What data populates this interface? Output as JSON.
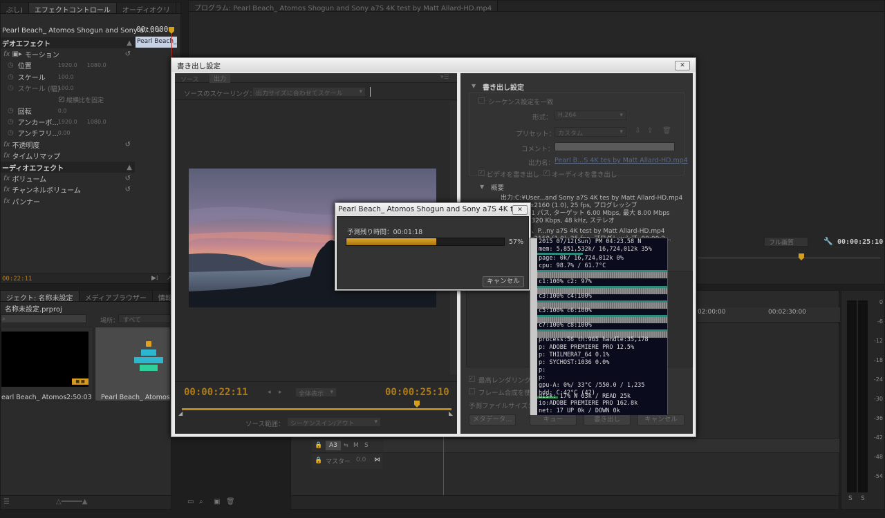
{
  "effect_panel": {
    "tabs": [
      "ぶし)",
      "エフェクトコントロール",
      "オーディオクリ"
    ],
    "clip_name": "Pearl Beach_ Atomos Shogun and Sony a7...",
    "timecode": "00:0000",
    "clip_bar": "Pearl Beach_",
    "current_time": "00:22:11",
    "rows": [
      {
        "label": "デオエフェクト",
        "kind": "header"
      },
      {
        "label": "モーション",
        "kind": "group"
      },
      {
        "label": "位置",
        "kind": "prop",
        "v1": "1920.0",
        "v2": "1080.0"
      },
      {
        "label": "スケール",
        "kind": "prop",
        "v1": "100.0",
        "v2": ""
      },
      {
        "label": "スケール (幅)",
        "kind": "prop-dim",
        "v1": "100.0",
        "v2": ""
      },
      {
        "label": "縦横比を固定",
        "kind": "check"
      },
      {
        "label": "回転",
        "kind": "prop",
        "v1": "0.0",
        "v2": ""
      },
      {
        "label": "アンカーポ...",
        "kind": "prop",
        "v1": "1920.0",
        "v2": "1080.0"
      },
      {
        "label": "アンチフリ...",
        "kind": "prop",
        "v1": "0.00",
        "v2": ""
      },
      {
        "label": "不透明度",
        "kind": "group"
      },
      {
        "label": "タイムリマップ",
        "kind": "group"
      },
      {
        "label": "ーディオエフェクト",
        "kind": "header"
      },
      {
        "label": "ボリューム",
        "kind": "group"
      },
      {
        "label": "チャンネルボリューム",
        "kind": "group"
      },
      {
        "label": "パンナー",
        "kind": "group"
      }
    ]
  },
  "project_panel": {
    "tabs": [
      "ジェクト: 名称未設定",
      "メディアブラウザー",
      "情報"
    ],
    "project_file": "名称未設定.prproj",
    "location_label": "場所：",
    "location_value": "すべて",
    "items": [
      {
        "name": "earl Beach_ Atomos...",
        "duration": "2:50:03"
      },
      {
        "name": "Pearl Beach_ Atomos S...",
        "duration": ""
      }
    ]
  },
  "program_monitor": {
    "tab": "プログラム: Pearl Beach_ Atomos Shogun and Sony a7S 4K test by Matt Allard-HD.mp4",
    "fit_label": "フル画質",
    "timecode": "00:00:25:10"
  },
  "timeline": {
    "ruler": [
      "02:00:00",
      "00:02:30:00"
    ],
    "tracks": [
      {
        "label": "A3",
        "m": "M",
        "s": "S"
      },
      {
        "label": "マスター",
        "value": "0.0"
      }
    ]
  },
  "audio_meter": {
    "scale": [
      "0",
      "-6",
      "-12",
      "-18",
      "-24",
      "-30",
      "-36",
      "-42",
      "-48",
      "-54"
    ],
    "solo": [
      "S",
      "S"
    ]
  },
  "export_dialog": {
    "title": "書き出し設定",
    "source_tabs": [
      "ソース",
      "出力"
    ],
    "scaling_label": "ソースのスケーリング：",
    "scaling_value": "出力サイズに合わせてスケール",
    "tc_in": "00:00:22:11",
    "tc_out": "00:00:25:10",
    "zoom_value": "全体表示",
    "source_range_label": "ソース範囲：",
    "source_range_value": "シーケンスイン/アウト",
    "export_settings_title": "書き出し設定",
    "match_sequence": "シーケンス設定を一致",
    "format_label": "形式：",
    "format_value": "H.264",
    "preset_label": "プリセット：",
    "preset_value": "カスタム",
    "comment_label": "コメント：",
    "output_name_label": "出力名：",
    "output_name_value": "Pearl B...S 4K tes by Matt Allard-HD.mp4",
    "export_video": "ビデオを書き出し",
    "export_audio": "オーディオを書き出し",
    "summary_title": "概要",
    "summary_lines": [
      "出力:C:¥User...and Sony a7S 4K tes by Matt Allard-HD.mp4",
      "3840x2160 (1.0), 25 fps, プログレッシブ",
      "VBR, 1 パス, ターゲット 6.00 Mbps, 最大 8.00 Mbps",
      "AAC, 320 Kbps, 48 kHz, ステレオ",
      "シーケンス、P...ny a7S 4K test by Matt Allard-HD.mp4",
      "3840x2160 (1.0), 25 fps, プログレッシブ, 00:00:2..."
    ],
    "max_render": "最高レンダリング品質を使用",
    "frame_blend": "フレーム合成を使用",
    "file_size_label": "予測ファイルサイズ：",
    "buttons": [
      "メタデータ...",
      "キュー",
      "書き出し",
      "キャンセル"
    ]
  },
  "progress_dialog": {
    "title": "Pearl Beach_ Atomos Shogun and Sony a7S 4K test ...",
    "remaining_label": "予測残り時間：00:01:18",
    "percent_text": "57%",
    "progress": 0.57,
    "cancel": "キャンセル"
  },
  "sys_monitor": {
    "lines": [
      "2015 07/12(Sun)    PM 04:23.58  N",
      "mem:   5,851,532k/ 16,724,012k 35%",
      "page:             0k/ 16,724,012k  0%",
      "cpu: 98.7% / 61.7°C",
      "c1:100%          c2: 97%",
      "c3:100%          c4:100%",
      "c5:100%          c6:100%",
      "c7:100%          c8:100%",
      "process:56 th:965 handle:35,178",
      "p: ADOBE PREMIERE PRO       12.5%",
      "p: THILMERA7_64              0.1%",
      "p: SYCHOST:1036              0.0%",
      "p:",
      "p:",
      "gpu-A:  0%/ 33°C /550.0 / 1,235",
      "hdd: C:42°C (42)",
      "disk: 17% W      63k / READ    25k",
      "io:ADOBE PREMIERE PRO      162.8k",
      "net:  17 UP        0k / DOWN     0k"
    ]
  },
  "colors": {
    "accent": "#ad7b1a",
    "progress": "#c08a18"
  }
}
